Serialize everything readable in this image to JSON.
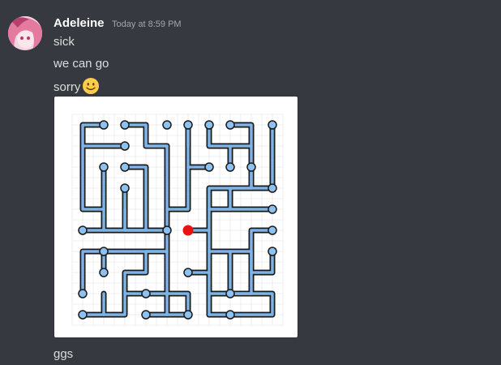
{
  "author": {
    "username": "Adeleine",
    "timestamp": "Today at 8:59 PM",
    "avatar_icon": "anime-avatar-icon"
  },
  "messages": [
    {
      "text": "sick"
    },
    {
      "text": "we can go"
    },
    {
      "text": "sorry",
      "emoji": "slightly-smiling-face-icon"
    },
    {
      "text": "ggs"
    }
  ],
  "attachment": {
    "type": "image",
    "icon": "maze-puzzle-icon",
    "grid": {
      "cols": 10,
      "rows": 10
    },
    "colors": {
      "background": "#36393f",
      "pipe_fill": "#7fb3e6",
      "pipe_outline": "#1a1a1a",
      "node": "#8dc2f0",
      "marker": "#e81010",
      "grid_line": "#e0e0e0"
    }
  }
}
